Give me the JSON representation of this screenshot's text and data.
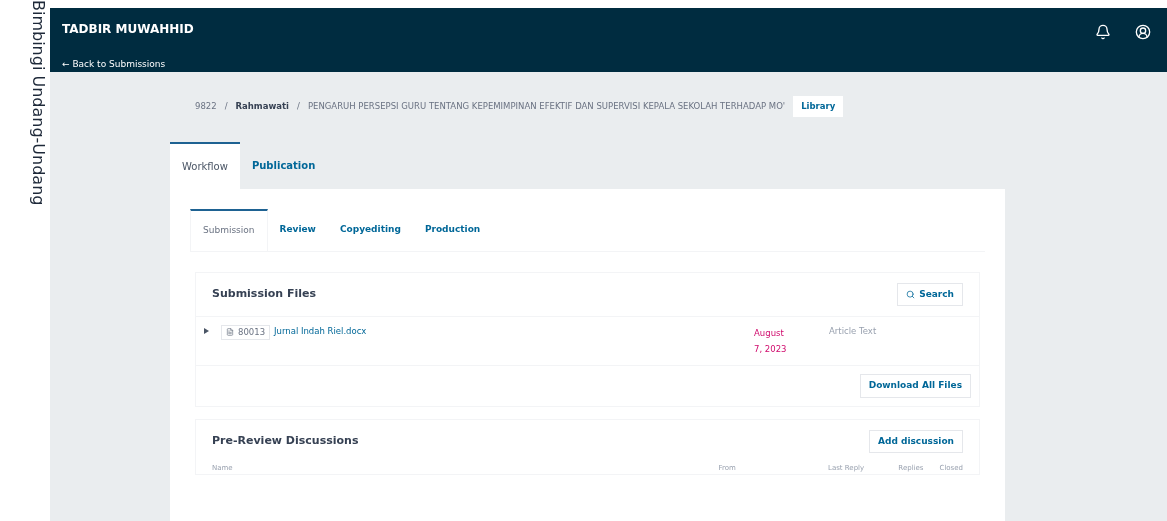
{
  "side_text": "Bimbingi Undang-Undang",
  "header": {
    "title": "TADBIR MUWAHHID",
    "back_link": "← Back to Submissions"
  },
  "breadcrumb": {
    "separator": "/",
    "id": "9822",
    "author": "Rahmawati",
    "title": "PENGARUH PERSEPSI GURU TENTANG KEPEMIMPINAN EFEKTIF DAN SUPERVISI KEPALA SEKOLAH TERHADAP MO'",
    "library_button": "Library"
  },
  "tabs": [
    {
      "label": "Workflow",
      "selected": true
    },
    {
      "label": "Publication",
      "selected": false
    }
  ],
  "stage_tabs": [
    {
      "label": "Submission",
      "selected": true
    },
    {
      "label": "Review",
      "selected": false
    },
    {
      "label": "Copyediting",
      "selected": false
    },
    {
      "label": "Production",
      "selected": false
    }
  ],
  "submission_files": {
    "title": "Submission Files",
    "search_button": "Search",
    "files": [
      {
        "id": "80013",
        "name": "Jurnal Indah Riel.docx",
        "date_line_1": "August",
        "date_line_2": "7, 2023",
        "type": "Article Text"
      }
    ],
    "download_button": "Download All Files"
  },
  "discussions": {
    "title": "Pre-Review Discussions",
    "add_button": "Add discussion",
    "columns": [
      "Name",
      "From",
      "Last Reply",
      "Replies",
      "Closed"
    ]
  }
}
